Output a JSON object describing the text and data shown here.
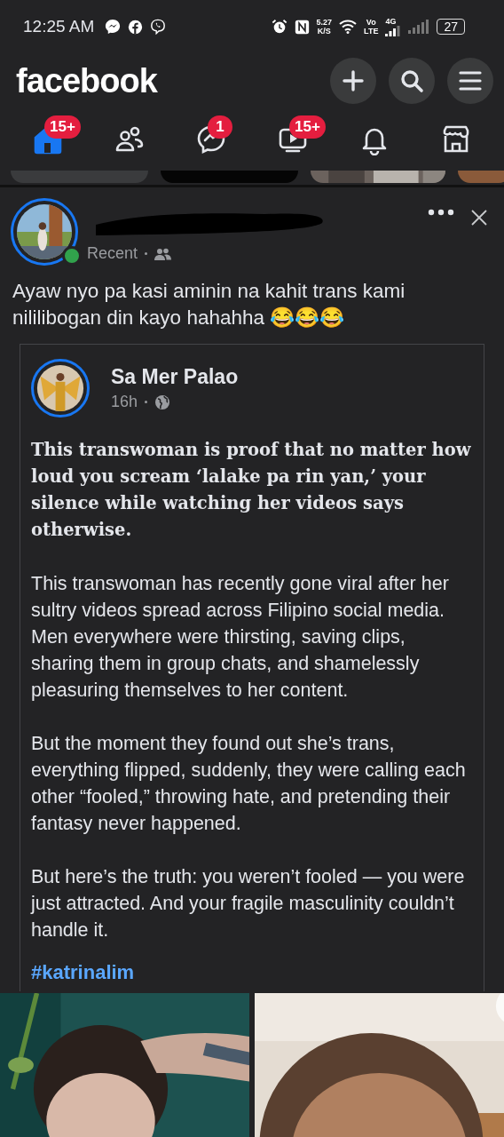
{
  "status_bar": {
    "time": "12:25 AM",
    "speed": "5.27",
    "speed_unit": "K/S",
    "volte_top": "Vo",
    "volte_bottom": "LTE",
    "network": "4G",
    "battery": "27"
  },
  "header": {
    "logo": "facebook"
  },
  "nav_tabs": [
    {
      "kind": "home",
      "badge": "15+",
      "selected": true
    },
    {
      "kind": "friends",
      "selected": false
    },
    {
      "kind": "messenger",
      "badge": "1",
      "selected": false
    },
    {
      "kind": "video",
      "badge": "15+",
      "selected": false
    },
    {
      "kind": "notifications",
      "selected": false
    },
    {
      "kind": "marketplace",
      "selected": false
    }
  ],
  "post": {
    "online": true,
    "meta": "Recent",
    "text": "Ayaw nyo pa kasi aminin na kahit trans kami nililibogan din kayo hahahha 😂😂😂",
    "shared": {
      "author": "Sa Mer Palao",
      "time": "16h",
      "paragraphs": [
        {
          "kind": "bold",
          "text": "This transwoman is proof that no matter how loud you scream ‘lalake pa rin yan,’ your silence while watching her videos says otherwise."
        },
        {
          "kind": "plain",
          "text": "This transwoman has recently gone viral after her sultry videos spread across Filipino social media. Men everywhere were thirsting, saving clips, sharing them in group chats, and shamelessly pleasuring themselves to her content."
        },
        {
          "kind": "plain",
          "text": "But the moment they found out she’s trans, everything flipped, suddenly, they were calling each other “fooled,” throwing hate, and pretending their fantasy never happened."
        },
        {
          "kind": "plain",
          "text": "But here’s the truth: you weren’t fooled — you were just attracted. And your fragile masculinity couldn’t handle it."
        },
        {
          "kind": "hashtag",
          "text": "#katrinalim"
        }
      ]
    }
  }
}
